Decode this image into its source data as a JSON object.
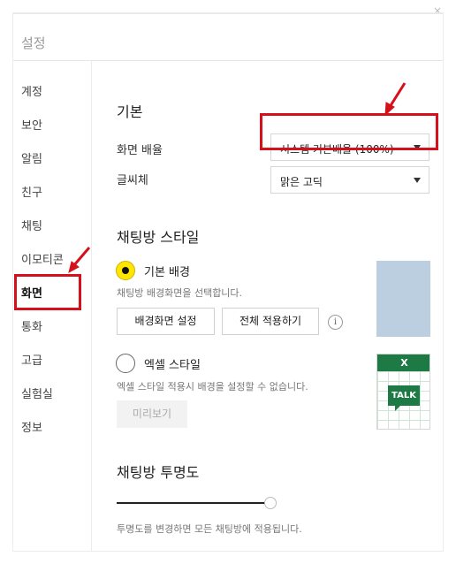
{
  "window": {
    "title": "설정",
    "close_glyph": "×"
  },
  "sidebar": {
    "items": [
      {
        "label": "계정"
      },
      {
        "label": "보안"
      },
      {
        "label": "알림"
      },
      {
        "label": "친구"
      },
      {
        "label": "채팅"
      },
      {
        "label": "이모티콘"
      },
      {
        "label": "화면",
        "active": true
      },
      {
        "label": "통화"
      },
      {
        "label": "고급"
      },
      {
        "label": "실험실"
      },
      {
        "label": "정보"
      }
    ]
  },
  "main": {
    "basic": {
      "heading": "기본",
      "zoom_label": "화면 배율",
      "zoom_value": "시스템 기본배율 (100%)",
      "font_label": "글씨체",
      "font_value": "맑은 고딕"
    },
    "chat_style": {
      "heading": "채팅방 스타일",
      "default_bg": {
        "label": "기본 배경",
        "selected": true,
        "description": "채팅방 배경화면을 선택합니다.",
        "set_button": "배경화면 설정",
        "apply_all_button": "전체 적용하기",
        "info_glyph": "i"
      },
      "excel": {
        "label": "엑셀 스타일",
        "selected": false,
        "description": "엑셀 스타일 적용시 배경을 설정할 수 없습니다.",
        "preview_button": "미리보기",
        "thumb_header": "X",
        "thumb_badge": "TALK"
      }
    },
    "transparency": {
      "heading": "채팅방 투명도",
      "value_fraction": 1.0,
      "description": "투명도를 변경하면 모든 채팅방에 적용됩니다."
    }
  },
  "colors": {
    "accent_yellow": "#ffe500",
    "highlight_red": "#d6101a",
    "excel_green": "#1e7a45",
    "bg_thumb_blue": "#bccfe0"
  }
}
